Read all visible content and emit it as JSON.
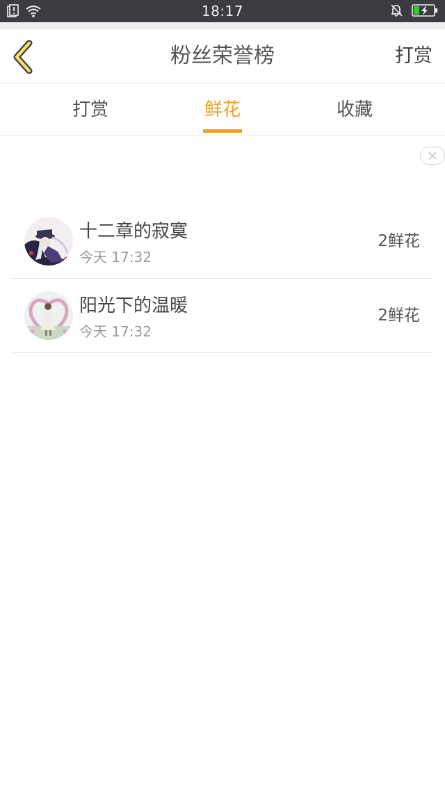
{
  "status_bar": {
    "time": "18:17",
    "icons_left": [
      "notification-alert-icon",
      "wifi-icon"
    ],
    "icons_right": [
      "bell-off-icon",
      "battery-charging-icon"
    ],
    "battery_color": "#3cc43c"
  },
  "navbar": {
    "back_icon": "chevron-left-icon",
    "title": "粉丝荣誉榜",
    "action_label": "打赏"
  },
  "tabs": [
    {
      "label": "打赏",
      "active": false
    },
    {
      "label": "鲜花",
      "active": true
    },
    {
      "label": "收藏",
      "active": false
    }
  ],
  "accent_color": "#f0a020",
  "ad_close_icon": "close-icon",
  "entries": [
    {
      "name": "十二章的寂寞",
      "time": "今天 17:32",
      "count": "2鲜花"
    },
    {
      "name": "阳光下的温暖",
      "time": "今天 17:32",
      "count": "2鲜花"
    }
  ]
}
